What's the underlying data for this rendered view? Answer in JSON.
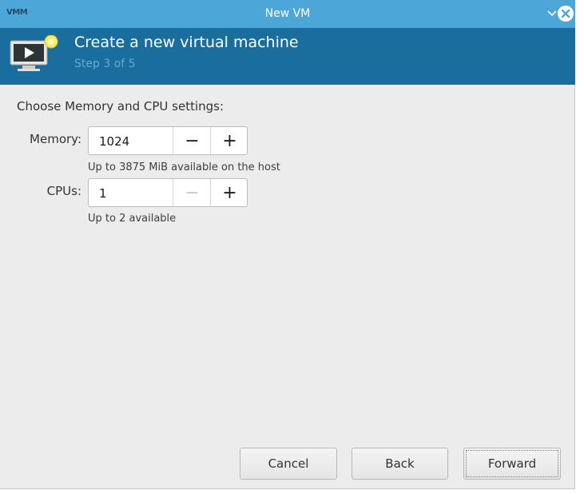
{
  "window": {
    "app_logo": "VMM",
    "title": "New VM"
  },
  "header": {
    "title": "Create a new virtual machine",
    "step": "Step 3 of 5"
  },
  "form": {
    "section_title": "Choose Memory and CPU settings:",
    "memory": {
      "label": "Memory:",
      "value": "1024",
      "minus": "−",
      "plus": "+",
      "hint": "Up to 3875 MiB available on the host"
    },
    "cpus": {
      "label": "CPUs:",
      "value": "1",
      "minus": "−",
      "plus": "+",
      "hint": "Up to 2 available"
    }
  },
  "footer": {
    "cancel_label": "Cancel",
    "back_label": "Back",
    "forward_label": "Forward"
  },
  "colors": {
    "titlebar": "#4da6d8",
    "header_bg": "#1a6e9e",
    "step_text": "#69a9cf",
    "body_bg": "#ececec"
  },
  "icons": [
    "collapse-icon",
    "close-icon",
    "vm-monitor-icon"
  ]
}
